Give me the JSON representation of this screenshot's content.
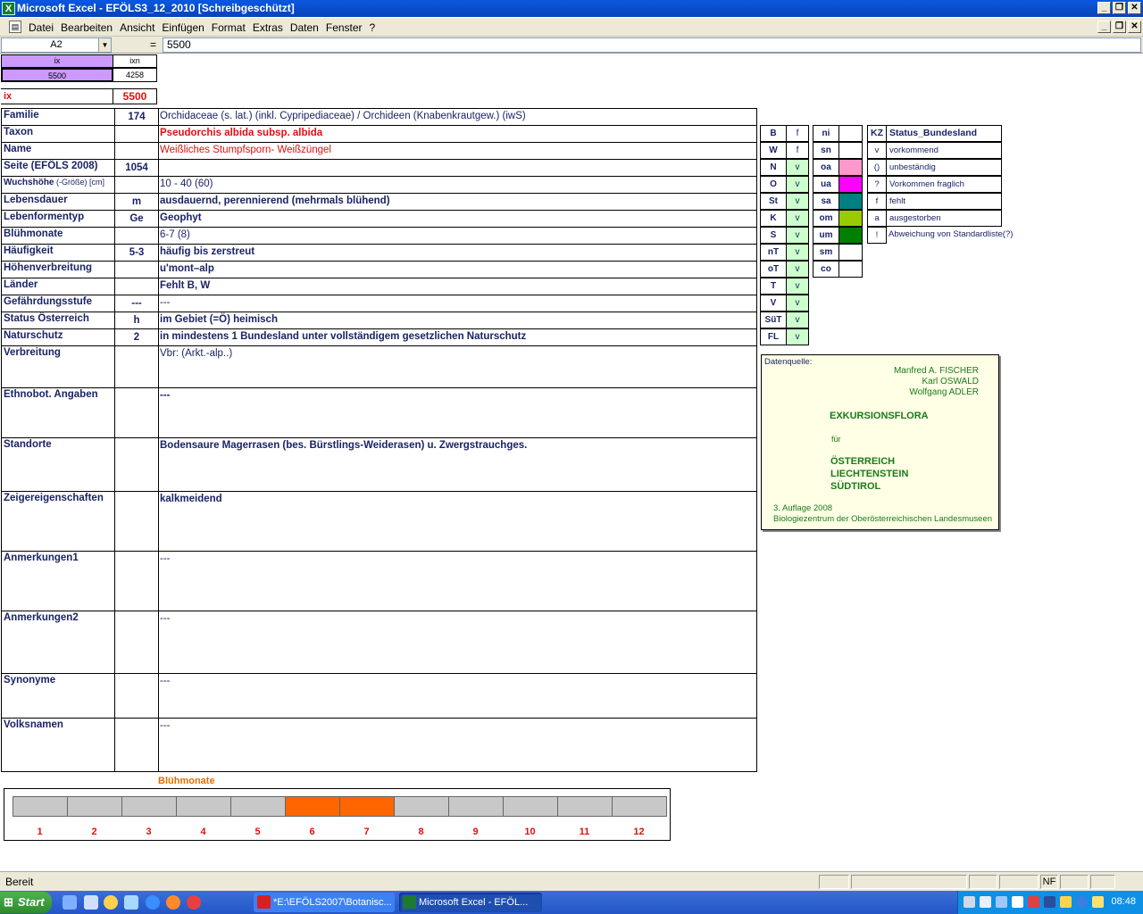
{
  "window": {
    "title": "Microsoft Excel - EFÖLS3_12_2010  [Schreibgeschützt]"
  },
  "menu": [
    "Datei",
    "Bearbeiten",
    "Ansicht",
    "Einfügen",
    "Format",
    "Extras",
    "Daten",
    "Fenster",
    "?"
  ],
  "formula_bar": {
    "name_box": "A2",
    "equals": "=",
    "formula": "5500"
  },
  "index_block": {
    "ix_header": "ix",
    "ixn_header": "ixn",
    "ix_value": "5500",
    "ixn_value": "4258",
    "ix_label": "ix",
    "ix_big": "5500"
  },
  "rows": [
    {
      "label": "Familie",
      "code": "174",
      "value": "Orchidaceae (s. lat.) (inkl. Cypripediaceae)  /  Orchideen (Knabenkrautgew.) (iwS)"
    },
    {
      "label": "Taxon",
      "code": "",
      "value": "Pseudorchis albida subsp. albida"
    },
    {
      "label": "Name",
      "code": "",
      "value": "Weißliches Stumpfsporn- Weißzüngel"
    },
    {
      "label": "Seite (EFÖLS 2008)",
      "code": "1054",
      "value": ""
    },
    {
      "label": "Wuchshöhe",
      "label_suffix": " (-Größe) [cm]",
      "code": "",
      "value": " 10 - 40 (60)"
    },
    {
      "label": "Lebensdauer",
      "code": "m",
      "value": "ausdauernd, perennierend (mehrmals blühend)"
    },
    {
      "label": "Lebenformentyp",
      "code": "Ge",
      "value": "Geophyt"
    },
    {
      "label": "Blühmonate",
      "code": "",
      "value": " 6-7 (8)"
    },
    {
      "label": "Häufigkeit",
      "code": "5-3",
      "value": "häufig bis zerstreut"
    },
    {
      "label": "Höhenverbreitung",
      "code": "",
      "value": "u'mont–alp"
    },
    {
      "label": "Länder",
      "code": "",
      "value": "Fehlt B, W"
    },
    {
      "label": "Gefährdungsstufe",
      "code": "---",
      "value": " ---"
    },
    {
      "label": "Status Österreich",
      "code": "h",
      "value": "im Gebiet (=Ö) heimisch"
    },
    {
      "label": "Naturschutz",
      "code": "2",
      "value": "in mindestens 1 Bundesland unter vollständigem gesetzlichen Naturschutz"
    },
    {
      "label": "Verbreitung",
      "code": "",
      "value": "Vbr: (Arkt.-alp..)"
    },
    {
      "label": "Ethnobot. Angaben",
      "code": "",
      "value": "---"
    },
    {
      "label": "Standorte",
      "code": "",
      "value": "Bodensaure Magerrasen (bes. Bürstlings-Weiderasen) u. Zwergstrauchges."
    },
    {
      "label": "Zeigereigenschaften",
      "code": "",
      "value": "kalkmeidend"
    },
    {
      "label": "Anmerkungen1",
      "code": "",
      "value": "---"
    },
    {
      "label": "Anmerkungen2",
      "code": "",
      "value": "---"
    },
    {
      "label": "Synonyme",
      "code": "",
      "value": "---"
    },
    {
      "label": "Volksnamen",
      "code": "",
      "value": "---"
    }
  ],
  "lands": [
    {
      "k": "B",
      "v": "f"
    },
    {
      "k": "W",
      "v": "f"
    },
    {
      "k": "N",
      "v": "v"
    },
    {
      "k": "O",
      "v": "v"
    },
    {
      "k": "St",
      "v": "v"
    },
    {
      "k": "K",
      "v": "v"
    },
    {
      "k": "S",
      "v": "v"
    },
    {
      "k": "nT",
      "v": "v"
    },
    {
      "k": "oT",
      "v": "v"
    },
    {
      "k": "T",
      "v": "v"
    },
    {
      "k": "V",
      "v": "v"
    },
    {
      "k": "SüT",
      "v": "v"
    },
    {
      "k": "FL",
      "v": "v"
    }
  ],
  "heights": [
    {
      "k": "ni",
      "color": "#ffffff"
    },
    {
      "k": "sn",
      "color": "#ffffff"
    },
    {
      "k": "oa",
      "color": "#ff99cc"
    },
    {
      "k": "ua",
      "color": "#ff00ff"
    },
    {
      "k": "sa",
      "color": "#008080"
    },
    {
      "k": "om",
      "color": "#99cc00"
    },
    {
      "k": "um",
      "color": "#008000"
    },
    {
      "k": "sm",
      "color": "#ffffff"
    },
    {
      "k": "co",
      "color": "#ffffff"
    }
  ],
  "status_legend": {
    "header_kz": "KZ",
    "header_title": "Status_Bundesland",
    "items": [
      {
        "kz": "v",
        "text": "vorkommend"
      },
      {
        "kz": "()",
        "text": "unbeständig"
      },
      {
        "kz": "?",
        "text": "Vorkommen fraglich"
      },
      {
        "kz": "f",
        "text": "fehlt"
      },
      {
        "kz": "a",
        "text": "ausgestorben"
      },
      {
        "kz": "!",
        "text": "Abweichung von Standardliste(?)"
      }
    ]
  },
  "source": {
    "heading": "Datenquelle:",
    "authors": [
      "Manfred A. FISCHER",
      "Karl OSWALD",
      "Wolfgang ADLER"
    ],
    "book": "EXKURSIONSFLORA",
    "fuer": "für",
    "regions": [
      "ÖSTERREICH",
      "LIECHTENSTEIN",
      "SÜDTIROL"
    ],
    "edition": "3. Auflage 2008",
    "publisher": "Biologiezentrum der Oberösterreichischen Landesmuseen"
  },
  "bluehmonate": {
    "title": "Blühmonate",
    "months": [
      "1",
      "2",
      "3",
      "4",
      "5",
      "6",
      "7",
      "8",
      "9",
      "10",
      "11",
      "12"
    ],
    "active": [
      6,
      7
    ]
  },
  "status_bar": {
    "text": "Bereit",
    "nf": "NF"
  },
  "taskbar": {
    "start": "Start",
    "tasks": [
      "*E:\\EFÖLS2007\\Botanisc...",
      "Microsoft Excel - EFÖL..."
    ],
    "clock": "08:48"
  }
}
